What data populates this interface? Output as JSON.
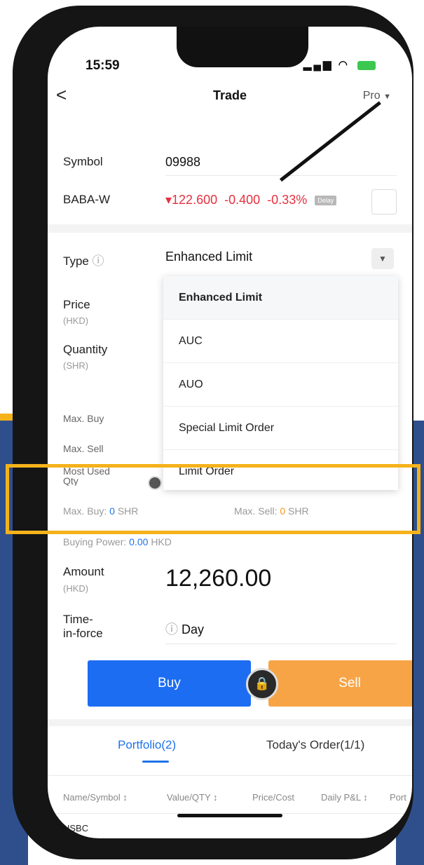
{
  "status": {
    "time": "15:59"
  },
  "nav": {
    "back": "<",
    "title": "Trade",
    "mode": "Pro"
  },
  "symbol": {
    "label": "Symbol",
    "value": "09988"
  },
  "quote": {
    "name": "BABA-W",
    "price": "▾122.600",
    "change": "-0.400",
    "change_pct": "-0.33%",
    "delay": "Delay"
  },
  "type": {
    "label": "Type",
    "value": "Enhanced Limit"
  },
  "dropdown": {
    "options": [
      "Enhanced Limit",
      "AUC",
      "AUO",
      "Special Limit Order",
      "Limit Order"
    ],
    "selected": "Enhanced Limit"
  },
  "price": {
    "label": "Price",
    "unit": "(HKD)"
  },
  "quantity": {
    "label": "Quantity",
    "unit": "(SHR)"
  },
  "limits": {
    "max_buy": "Max. Buy",
    "max_sell": "Max. Sell",
    "most_used": "Most Used Qty"
  },
  "info": {
    "max_buy_label": "Max. Buy:",
    "max_buy_value": "0",
    "max_buy_unit": "SHR",
    "max_sell_label": "Max. Sell:",
    "max_sell_value": "0",
    "max_sell_unit": "SHR",
    "bp_label": "Buying Power:",
    "bp_value": "0.00",
    "bp_unit": "HKD"
  },
  "amount": {
    "label": "Amount",
    "unit": "(HKD)",
    "value": "12,260.00"
  },
  "tif": {
    "label1": "Time-",
    "label2": "in-force",
    "value": "Day"
  },
  "actions": {
    "buy": "Buy",
    "sell": "Sell"
  },
  "tabs": {
    "portfolio": "Portfolio(2)",
    "orders": "Today's Order(1/1)"
  },
  "table": {
    "headers": [
      "Name/Symbol ↕",
      "Value/QTY ↕",
      "Price/Cost",
      "Daily P&L ↕",
      "Port"
    ],
    "row1_name": "HSBC"
  },
  "colors": {
    "buy": "#1c6df2",
    "sell": "#f7a447",
    "down": "#e8303e",
    "highlight": "#f5b21b",
    "background": "#2f4f8c"
  }
}
